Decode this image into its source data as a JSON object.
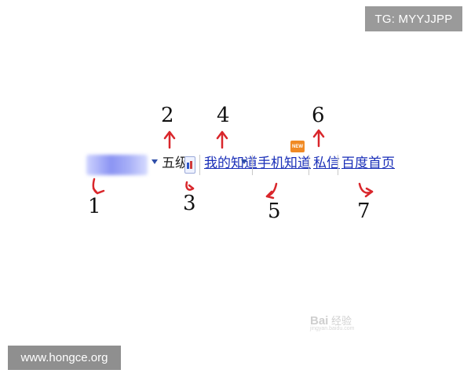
{
  "tag_label": "TG: MYYJJPP",
  "site_label": "www.hongce.org",
  "toolbar": {
    "level_text": "五级",
    "my_zhidao": "我的知道",
    "mobile_zhidao": "手机知道",
    "new_badge": "NEW",
    "private_msg": "私信",
    "baidu_home": "百度首页"
  },
  "annotations": [
    "1",
    "2",
    "3",
    "4",
    "5",
    "6",
    "7"
  ],
  "watermark": {
    "brand": "Bai",
    "suffix": "经验",
    "url": "jingyan.baidu.com"
  },
  "colors": {
    "link": "#1a2fb8",
    "annotation_arrow": "#d9262b",
    "badge": "#f08a24"
  }
}
